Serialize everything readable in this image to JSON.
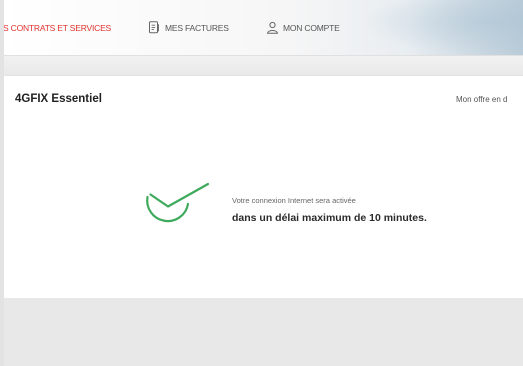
{
  "nav": {
    "contrats_label": "S CONTRATS ET SERVICES",
    "factures_label": "MES FACTURES",
    "compte_label": "MON COMPTE"
  },
  "card": {
    "title": "4GFIX Essentiel",
    "offer_link": "Mon offre en d",
    "message_line1": "Votre connexion Internet sera activée",
    "message_line2": "dans un délai maximum de 10 minutes."
  },
  "colors": {
    "accent_red": "#e1312d",
    "success_green": "#3daa5c"
  },
  "icons": {
    "factures": "invoice-icon",
    "compte": "user-icon",
    "status": "check-icon"
  }
}
